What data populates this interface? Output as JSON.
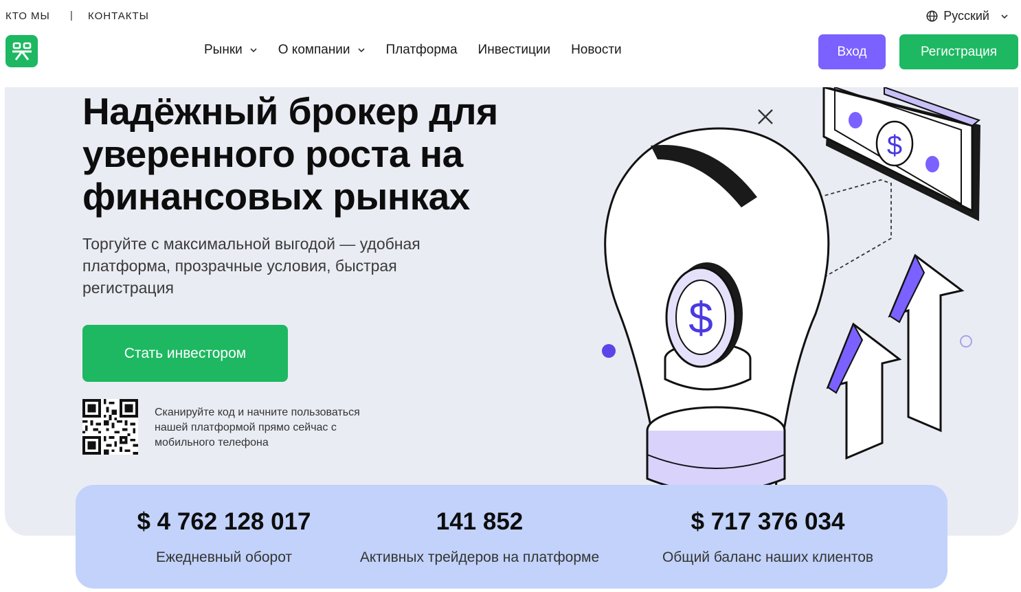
{
  "topbar": {
    "links": [
      "КТО МЫ",
      "КОНТАКТЫ"
    ],
    "separator": "|",
    "language": "Русский",
    "language_icon": "globe-icon"
  },
  "header": {
    "logo_icon": "brand-logo-icon",
    "nav": [
      {
        "label": "Рынки",
        "dropdown": true
      },
      {
        "label": "О компании",
        "dropdown": true
      },
      {
        "label": "Платформа",
        "dropdown": false
      },
      {
        "label": "Инвестиции",
        "dropdown": false
      },
      {
        "label": "Новости",
        "dropdown": false
      }
    ],
    "login_label": "Вход",
    "register_label": "Регистрация"
  },
  "hero": {
    "title_lines": [
      "Надёжный брокер для",
      "уверенного роста на",
      "финансовых рынках"
    ],
    "subtitle_lines": [
      "Торгуйте с максимальной выгодой — удобная",
      "платформа, прозрачные условия, быстрая",
      "регистрация"
    ],
    "cta_label": "Стать инвестором",
    "qr_text_lines": [
      "Сканируйте код и начните пользоваться",
      "нашей платформой прямо сейчас с",
      "мобильного телефона"
    ]
  },
  "stats": [
    {
      "value": "$ 4 762 128 017",
      "label": "Ежедневный оборот"
    },
    {
      "value": "141 852",
      "label": "Активных трейдеров на платформе"
    },
    {
      "value": "$ 717 376 034",
      "label": "Общий баланс наших клиентов"
    }
  ],
  "colors": {
    "brand_green": "#1db861",
    "accent_purple": "#7b61ff",
    "hero_bg": "#eaecf4",
    "stats_bg": "#c2d2fa"
  }
}
